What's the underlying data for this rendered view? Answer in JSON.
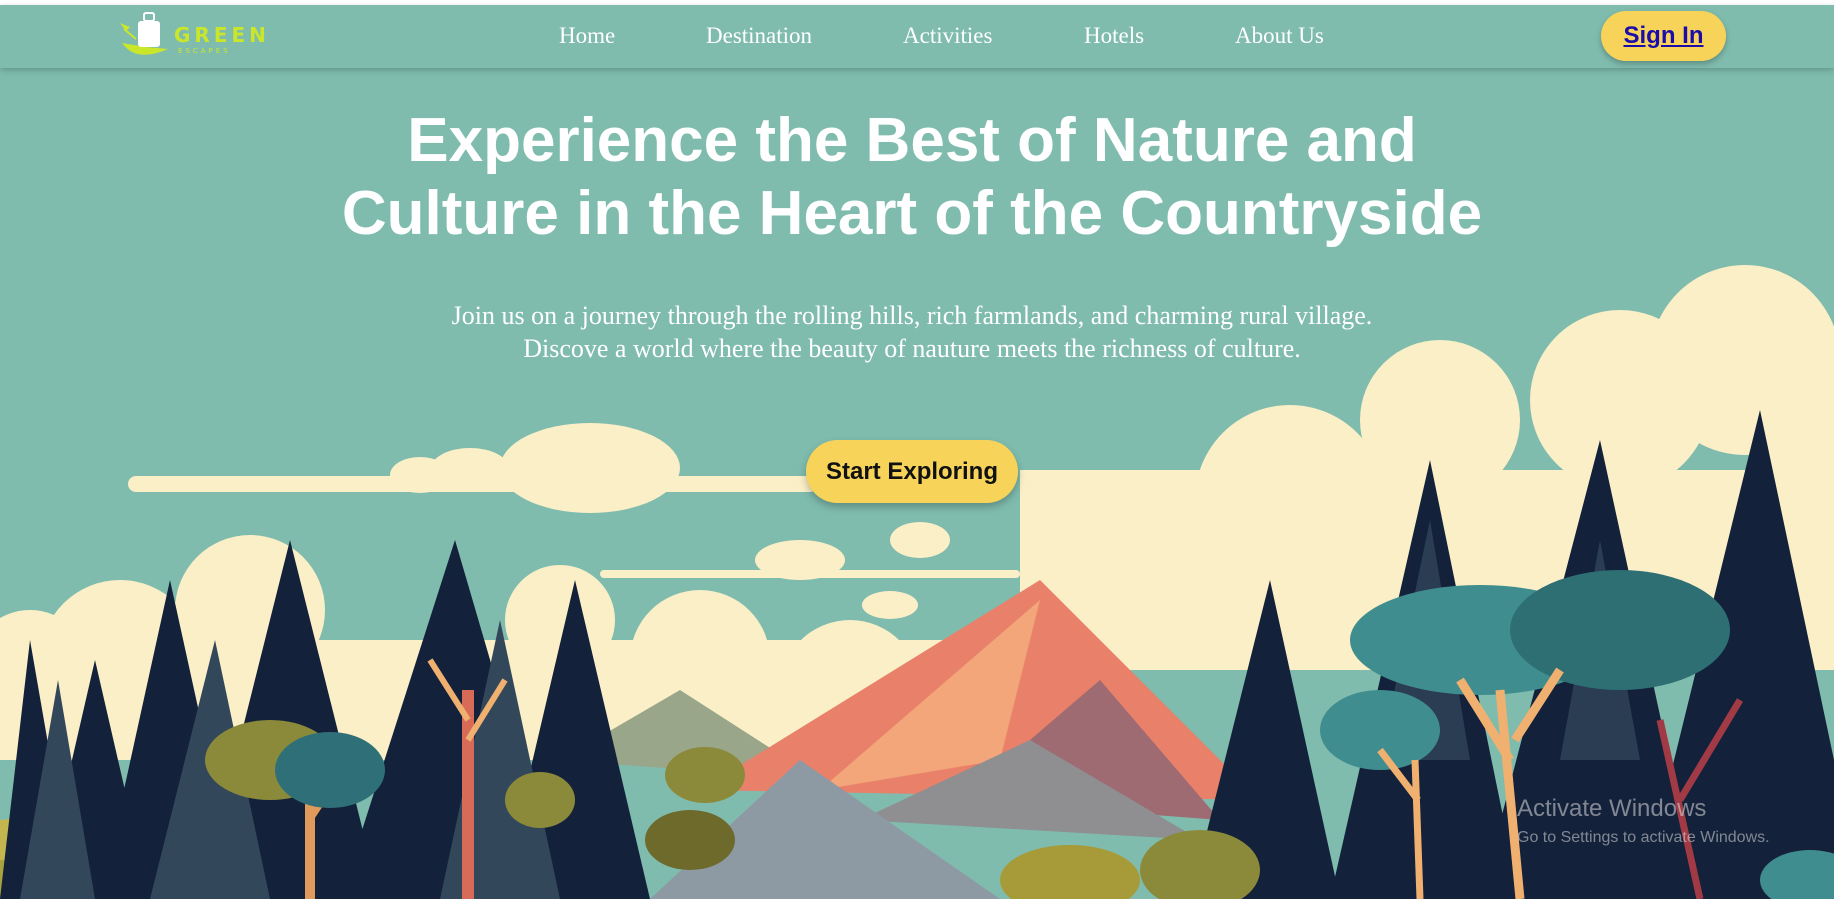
{
  "brand": {
    "logo_word": "GREEN",
    "logo_sub": "ESCAPES",
    "logo_color": "#c9e62a"
  },
  "nav": {
    "items": [
      {
        "label": "Home"
      },
      {
        "label": "Destination"
      },
      {
        "label": "Activities"
      },
      {
        "label": "Hotels"
      },
      {
        "label": "About Us"
      }
    ],
    "signin_label": "Sign In"
  },
  "hero": {
    "title_line1": "Experience the Best of Nature and",
    "title_line2": "Culture in the Heart of the Countryside",
    "subtitle_line1": "Join us on a journey through the rolling hills, rich farmlands, and charming rural village.",
    "subtitle_line2": "Discove a world where the beauty of nauture meets the richness of culture.",
    "cta_label": "Start Exploring"
  },
  "watermark": {
    "line1": "Activate Windows",
    "line2": "Go to Settings to activate Windows."
  },
  "colors": {
    "sky": "#7fbcae",
    "accent_yellow": "#f8d35a",
    "cloud": "#fbefc7",
    "tree_dark": "#13213a",
    "mountain": "#e8806a"
  }
}
